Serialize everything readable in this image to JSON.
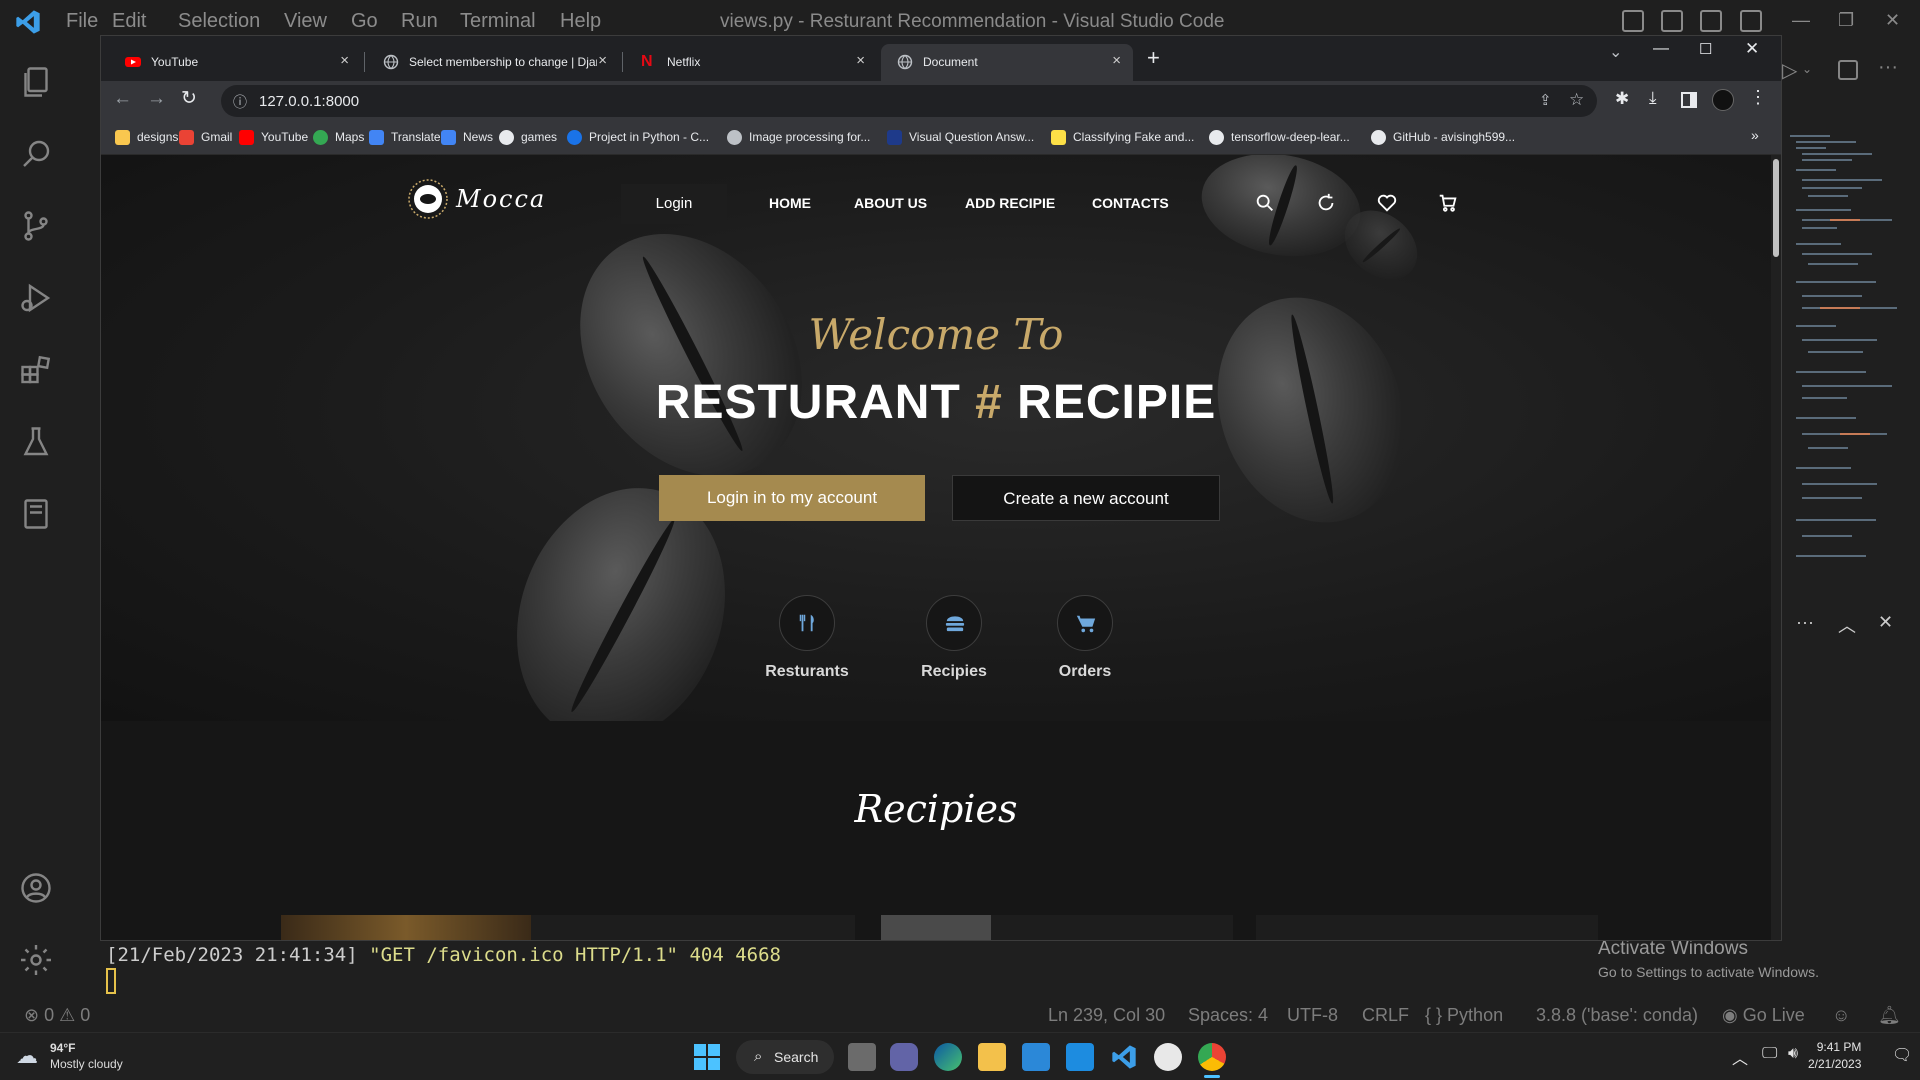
{
  "vscode": {
    "menu": [
      "File",
      "Edit",
      "Selection",
      "View",
      "Go",
      "Run",
      "Terminal",
      "Help"
    ],
    "title": "views.py - Resturant Recommendation - Visual Studio Code",
    "terminal": {
      "timestamp": "[21/Feb/2023 21:41:34]",
      "request": "\"GET /favicon.ico HTTP/1.1\"",
      "status": "404 4668"
    },
    "status_bar": {
      "errors": "0",
      "warnings": "0",
      "position": "Ln 239, Col 30",
      "spaces": "Spaces: 4",
      "encoding": "UTF-8",
      "eol": "CRLF",
      "language": "Python",
      "interpreter": "3.8.8 ('base': conda)",
      "go_live": "Go Live"
    },
    "watermark": {
      "title": "Activate Windows",
      "subtitle": "Go to Settings to activate Windows."
    }
  },
  "browser": {
    "tabs": [
      {
        "title": "YouTube",
        "icon": "youtube-icon",
        "active": false
      },
      {
        "title": "Select membership to change | Djan",
        "icon": "globe-icon",
        "active": false
      },
      {
        "title": "Netflix",
        "icon": "netflix-icon",
        "active": false
      },
      {
        "title": "Document",
        "icon": "globe-icon",
        "active": true
      }
    ],
    "new_tab": "+",
    "url": "127.0.0.1:8000",
    "bookmarks": [
      "designs",
      "Gmail",
      "YouTube",
      "Maps",
      "Translate",
      "News",
      "games",
      "Project in Python - C...",
      "Image processing for...",
      "Visual Question Answ...",
      "Classifying Fake and...",
      "tensorflow-deep-lear...",
      "GitHub - avisingh599..."
    ],
    "bookmarks_more": "»"
  },
  "site": {
    "logo": "Mocca",
    "login": "Login",
    "nav": [
      "HOME",
      "ABOUT US",
      "ADD RECIPIE",
      "CONTACTS"
    ],
    "welcome": "Welcome To",
    "headline_left": "RESTURANT",
    "headline_hash": "#",
    "headline_right": "RECIPIE",
    "btn_login": "Login in to my account",
    "btn_create": "Create a new account",
    "categories": [
      "Resturants",
      "Recipies",
      "Orders"
    ],
    "section_title": "Recipies"
  },
  "taskbar": {
    "temperature": "94°F",
    "weather": "Mostly cloudy",
    "search": "Search",
    "time": "9:41 PM",
    "date": "2/21/2023"
  },
  "colors": {
    "accent_gold": "#c8a96a",
    "button_gold": "#a58a4f",
    "vscode_bg": "#1f1f1f",
    "chrome_bg": "#202124"
  }
}
